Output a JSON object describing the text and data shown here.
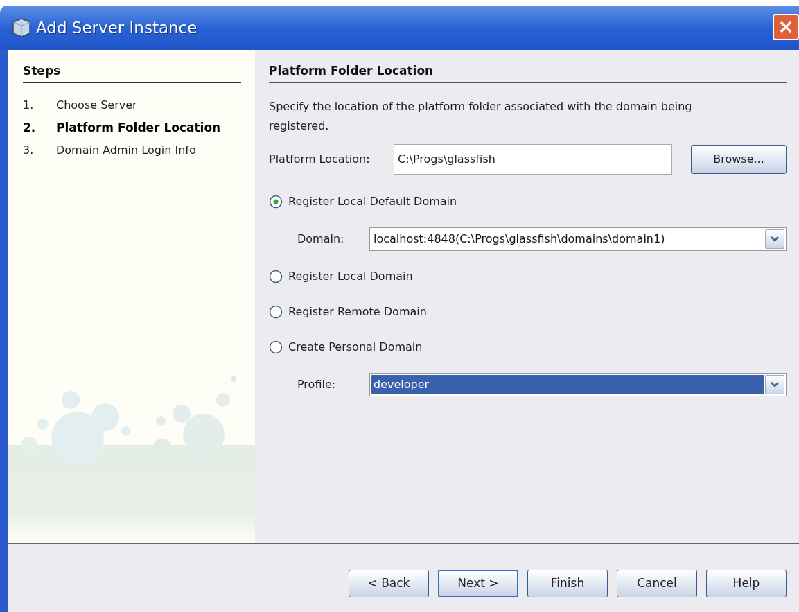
{
  "window": {
    "title": "Add Server Instance"
  },
  "steps": {
    "heading": "Steps",
    "items": [
      {
        "number": "1.",
        "label": "Choose Server",
        "selected": false
      },
      {
        "number": "2.",
        "label": "Platform Folder Location",
        "selected": true
      },
      {
        "number": "3.",
        "label": "Domain Admin Login Info",
        "selected": false
      }
    ]
  },
  "panel": {
    "heading": "Platform Folder Location",
    "description": "Specify the location of the platform folder associated with the domain being registered.",
    "platform_location": {
      "label": "Platform Location:",
      "value": "C:\\Progs\\glassfish"
    },
    "browse_button": "Browse...",
    "options": [
      {
        "kind": "radio",
        "label": "Register Local Default Domain",
        "selected": true
      },
      {
        "kind": "combo",
        "label": "Domain:",
        "value": "localhost:4848(C:\\Progs\\glassfish\\domains\\domain1)",
        "highlighted": false
      },
      {
        "kind": "radio",
        "label": "Register Local Domain",
        "selected": false
      },
      {
        "kind": "radio",
        "label": "Register Remote Domain",
        "selected": false
      },
      {
        "kind": "radio",
        "label": "Create Personal Domain",
        "selected": false
      },
      {
        "kind": "combo",
        "label": "Profile:",
        "value": "developer",
        "highlighted": true
      }
    ]
  },
  "buttons": [
    {
      "label": "< Back",
      "default": false
    },
    {
      "label": "Next >",
      "default": true
    },
    {
      "label": "Finish",
      "default": false
    },
    {
      "label": "Cancel",
      "default": false
    },
    {
      "label": "Help",
      "default": false
    }
  ]
}
